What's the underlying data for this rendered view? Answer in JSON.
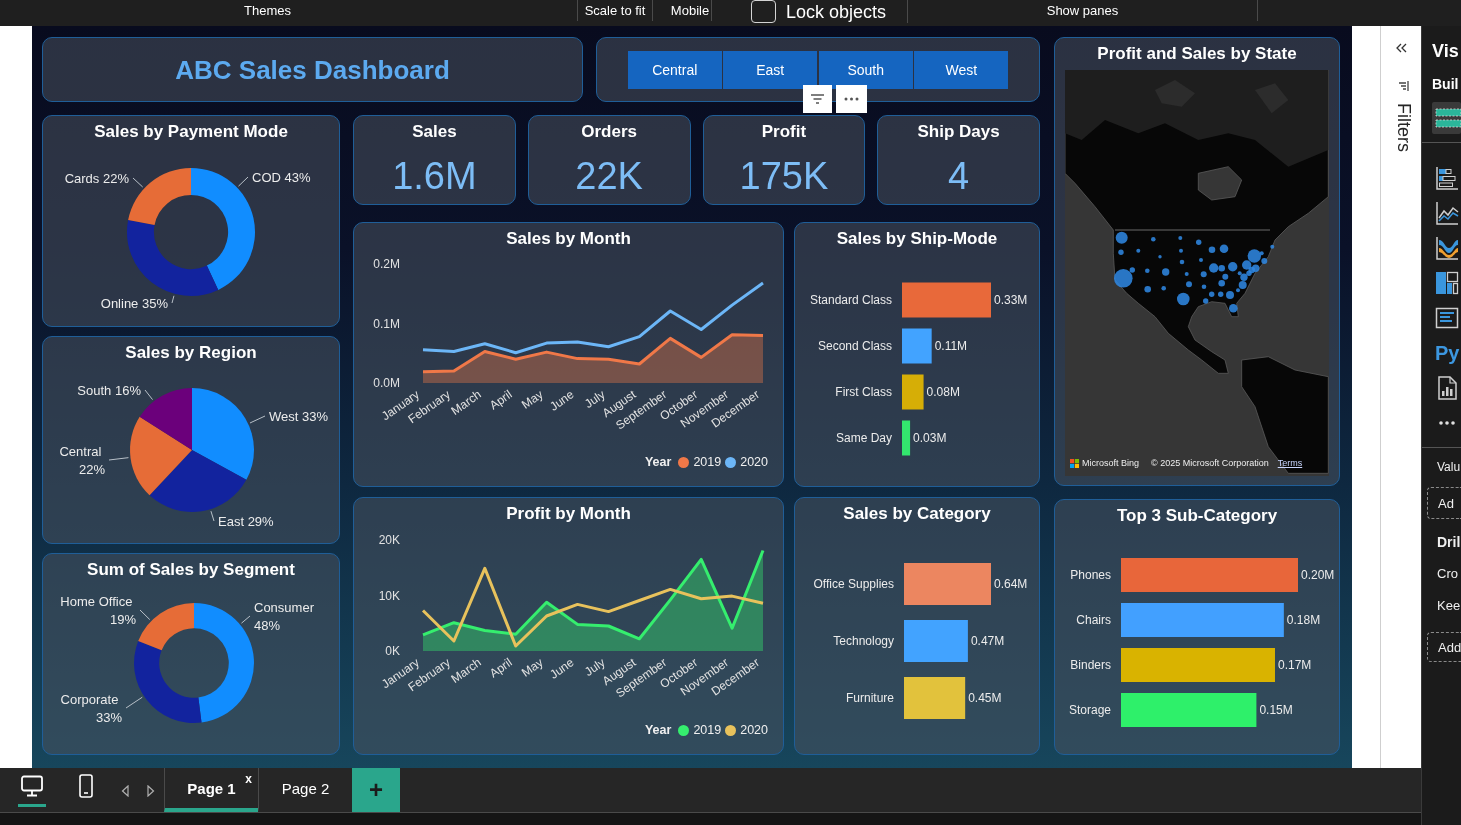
{
  "toolbar": {
    "items": [
      {
        "kind": "button",
        "label": "Themes"
      },
      {
        "kind": "button",
        "label": "Scale to fit"
      },
      {
        "kind": "button",
        "label": "Mobile"
      },
      {
        "kind": "checkbox",
        "label": "Lock objects",
        "checked": false
      },
      {
        "kind": "button",
        "label": "Show panes"
      }
    ]
  },
  "dashboard": {
    "title": "ABC Sales Dashboard",
    "region_slicer": {
      "items": [
        {
          "label": "Central",
          "selected": false
        },
        {
          "label": "East",
          "selected": false
        },
        {
          "label": "South",
          "selected": false
        },
        {
          "label": "West",
          "selected": false
        }
      ]
    },
    "kpis": [
      {
        "label": "Sales",
        "value": "1.6M"
      },
      {
        "label": "Orders",
        "value": "22K"
      },
      {
        "label": "Profit",
        "value": "175K"
      },
      {
        "label": "Ship Days",
        "value": "4"
      }
    ],
    "sales_by_payment_mode": {
      "title": "Sales by Payment Mode",
      "chart_data": {
        "type": "donut",
        "categories": [
          "COD",
          "Online",
          "Cards"
        ],
        "values": [
          43,
          35,
          22
        ],
        "colors": [
          "#118dff",
          "#12239e",
          "#e66c37"
        ],
        "value_labels": [
          "43%",
          "35%",
          "22%"
        ]
      }
    },
    "sales_by_region": {
      "title": "Sales by Region",
      "chart_data": {
        "type": "pie",
        "categories": [
          "West",
          "East",
          "Central",
          "South"
        ],
        "values": [
          33,
          29,
          22,
          16
        ],
        "colors": [
          "#118dff",
          "#12239e",
          "#e66c37",
          "#6b007b"
        ],
        "value_labels": [
          "33%",
          "29%",
          "22%",
          "16%"
        ]
      }
    },
    "sales_by_segment": {
      "title": "Sum of Sales by Segment",
      "chart_data": {
        "type": "donut",
        "categories": [
          "Consumer",
          "Corporate",
          "Home Office"
        ],
        "values": [
          48,
          33,
          19
        ],
        "colors": [
          "#118dff",
          "#12239e",
          "#e66c37"
        ],
        "value_labels": [
          "48%",
          "33%",
          "19%"
        ]
      }
    },
    "sales_by_month": {
      "title": "Sales by Month",
      "chart_data": {
        "type": "line",
        "x": [
          "January",
          "February",
          "March",
          "April",
          "May",
          "June",
          "July",
          "August",
          "September",
          "October",
          "November",
          "December"
        ],
        "series": [
          {
            "name": "2019",
            "type": "area",
            "color": "#f07848",
            "values": [
              0.019,
              0.02,
              0.053,
              0.04,
              0.052,
              0.041,
              0.04,
              0.032,
              0.075,
              0.043,
              0.081,
              0.08
            ]
          },
          {
            "name": "2020",
            "type": "line",
            "color": "#6cb6f7",
            "values": [
              0.056,
              0.053,
              0.066,
              0.051,
              0.067,
              0.069,
              0.061,
              0.078,
              0.121,
              0.09,
              0.131,
              0.168
            ]
          }
        ],
        "ylim": [
          0,
          0.2
        ],
        "yticks": [
          {
            "value": 0,
            "label": "0.0M"
          },
          {
            "value": 0.1,
            "label": "0.1M"
          },
          {
            "value": 0.2,
            "label": "0.2M"
          }
        ],
        "legend": {
          "title": "Year"
        }
      }
    },
    "sales_by_ship_mode": {
      "title": "Sales by Ship-Mode",
      "chart_data": {
        "type": "bar",
        "orientation": "horizontal",
        "categories": [
          "Standard Class",
          "Second Class",
          "First Class",
          "Same Day"
        ],
        "values": [
          0.33,
          0.11,
          0.08,
          0.03
        ],
        "colors": [
          "#e8693a",
          "#42a3ff",
          "#d6ae06",
          "#33e66e"
        ],
        "value_labels": [
          "0.33M",
          "0.11M",
          "0.08M",
          "0.03M"
        ]
      }
    },
    "state_map": {
      "title": "Profit and Sales by State",
      "attribution": "Microsoft Bing",
      "copyright": "© 2025 Microsoft Corporation",
      "terms_link": "Terms"
    },
    "profit_by_month": {
      "title": "Profit by Month",
      "chart_data": {
        "type": "line",
        "x": [
          "January",
          "February",
          "March",
          "April",
          "May",
          "June",
          "July",
          "August",
          "September",
          "October",
          "November",
          "December"
        ],
        "series": [
          {
            "name": "2019",
            "type": "area",
            "color": "#35ee6e",
            "values": [
              2.9,
              5.1,
              3.7,
              3.0,
              8.8,
              4.8,
              4.5,
              2.2,
              9.2,
              16.5,
              4.1,
              18.1
            ]
          },
          {
            "name": "2020",
            "type": "line",
            "color": "#e8c25c",
            "values": [
              7.3,
              1.8,
              14.9,
              0.9,
              6.3,
              8.4,
              7.1,
              9.1,
              11.1,
              9.4,
              9.9,
              8.6
            ]
          }
        ],
        "ylim": [
          0,
          20
        ],
        "yticks": [
          {
            "value": 0,
            "label": "0K"
          },
          {
            "value": 10,
            "label": "10K"
          },
          {
            "value": 20,
            "label": "20K"
          }
        ],
        "legend": {
          "title": "Year"
        }
      }
    },
    "sales_by_category": {
      "title": "Sales by Category",
      "chart_data": {
        "type": "bar",
        "orientation": "horizontal",
        "categories": [
          "Office Supplies",
          "Technology",
          "Furniture"
        ],
        "values": [
          0.64,
          0.47,
          0.45
        ],
        "colors": [
          "#ec8660",
          "#42a3ff",
          "#e2c23c"
        ],
        "value_labels": [
          "0.64M",
          "0.47M",
          "0.45M"
        ]
      }
    },
    "top_sub_category": {
      "title": "Top 3 Sub-Category",
      "chart_data": {
        "type": "bar",
        "orientation": "horizontal",
        "categories": [
          "Phones",
          "Chairs",
          "Binders",
          "Storage"
        ],
        "values": [
          0.2,
          0.184,
          0.174,
          0.153
        ],
        "colors": [
          "#e8663a",
          "#42a0ff",
          "#d9b300",
          "#2ef06a"
        ],
        "value_labels": [
          "0.20M",
          "0.18M",
          "0.17M",
          "0.15M"
        ]
      }
    }
  },
  "filters_pane": {
    "label": "Filters"
  },
  "visualizations_pane": {
    "title": "Vis",
    "subtitle": "Buil",
    "python_visual": "Py",
    "values_label": "Valu",
    "values_well": "Ad",
    "drillthrough_label": "Dril",
    "cross_report_label": "Cro",
    "keep_filters_label": "Kee",
    "drillthrough_well": "Add"
  },
  "views": [
    {
      "kind": "desktop",
      "selected": true
    },
    {
      "kind": "mobile",
      "selected": false
    }
  ],
  "pages": [
    {
      "label": "Page 1",
      "selected": true,
      "close": "x"
    },
    {
      "label": "Page 2",
      "selected": false
    }
  ],
  "add_page": "+"
}
